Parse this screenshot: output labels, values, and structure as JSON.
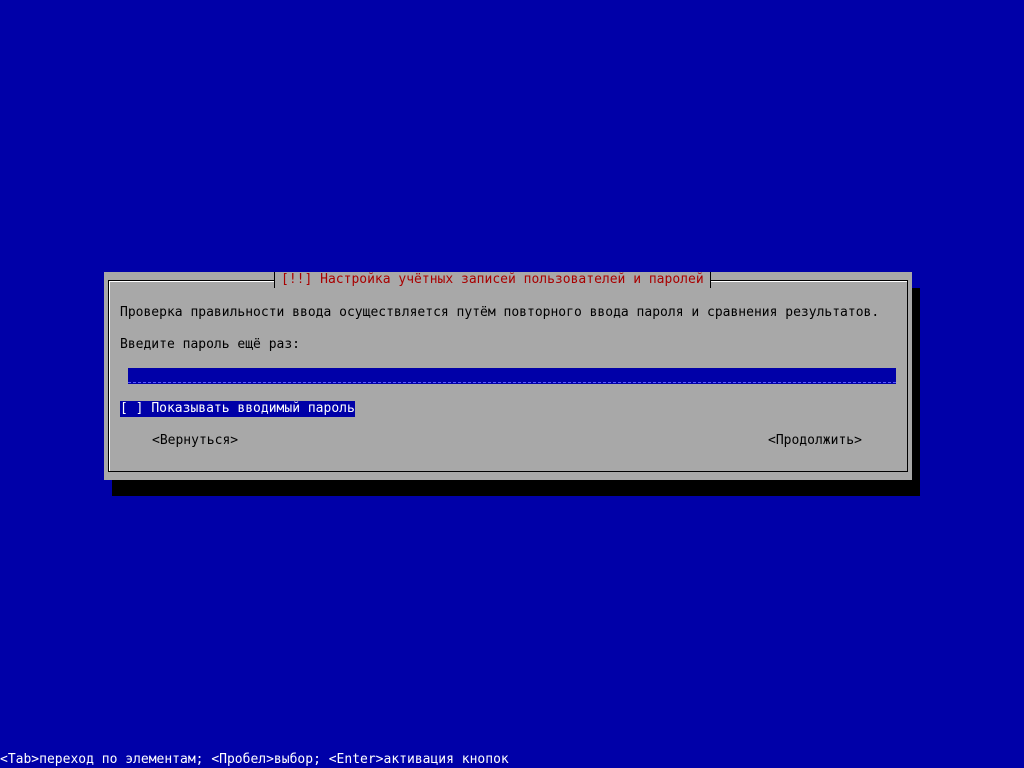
{
  "dialog": {
    "title": "[!!] Настройка учётных записей пользователей и паролей",
    "description": "Проверка правильности ввода осуществляется путём повторного ввода пароля и сравнения результатов.",
    "prompt": "Введите пароль ещё раз:",
    "password_value": "",
    "checkbox_mark": "[ ]",
    "checkbox_label": "Показывать вводимый пароль",
    "back_button": "<Вернуться>",
    "continue_button": "<Продолжить>"
  },
  "helpbar": {
    "text": "<Tab>переход по элементам; <Пробел>выбор; <Enter>активация кнопок"
  },
  "colors": {
    "background": "#0000a8",
    "dialog": "#a8a8a8",
    "title": "#a80000",
    "highlight": "#0000a8"
  }
}
